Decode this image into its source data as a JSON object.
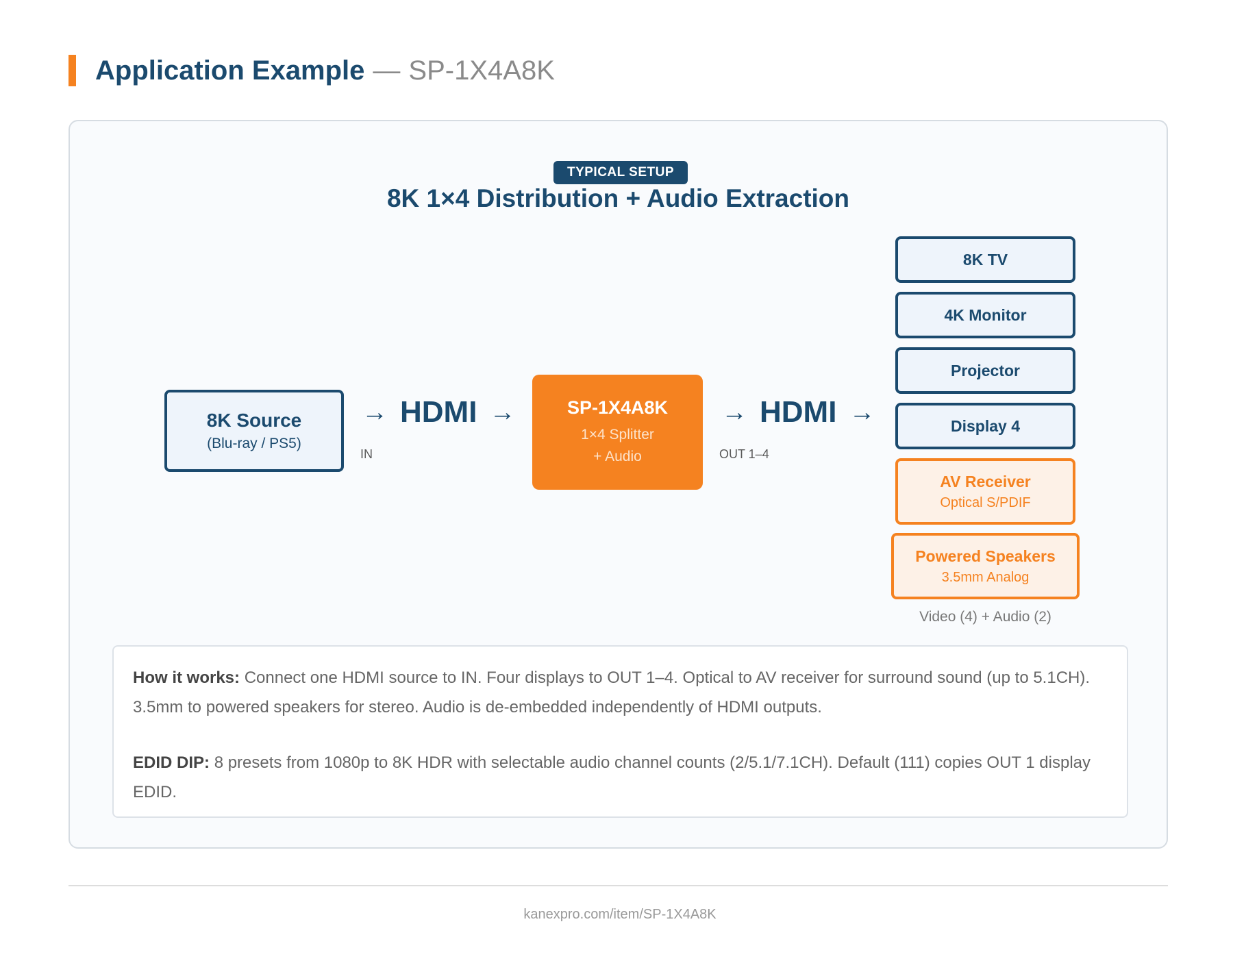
{
  "header": {
    "title": "Application Example",
    "separator": "—",
    "model": "SP-1X4A8K"
  },
  "diagram": {
    "badge": "TYPICAL SETUP",
    "title": "8K 1×4 Distribution + Audio Extraction",
    "source": {
      "name": "8K Source",
      "sub": "(Blu-ray / PS5)"
    },
    "input_link": {
      "arrow_left": "→",
      "label": "HDMI",
      "arrow_right": "→",
      "port": "IN"
    },
    "splitter": {
      "name": "SP-1X4A8K",
      "line1": "1×4 Splitter",
      "line2": "+ Audio"
    },
    "output_link": {
      "arrow_left": "→",
      "label": "HDMI",
      "arrow_right": "→",
      "port": "OUT 1–4"
    },
    "destinations": [
      {
        "name": "8K TV"
      },
      {
        "name": "4K Monitor"
      },
      {
        "name": "Projector"
      },
      {
        "name": "Display 4"
      },
      {
        "name": "AV Receiver",
        "sub": "Optical S/PDIF"
      },
      {
        "name": "Powered Speakers",
        "sub": "3.5mm Analog"
      }
    ],
    "outputs_note": "Video (4) + Audio (2)"
  },
  "info": {
    "how_label": "How it works:",
    "how_text": "Connect one HDMI source to IN. Four displays to OUT 1–4. Optical to AV receiver for surround sound (up to 5.1CH). 3.5mm to powered speakers for stereo. Audio is de-embedded independently of HDMI outputs.",
    "edid_label": "EDID DIP:",
    "edid_text": "8 presets from 1080p to 8K HDR with selectable audio channel counts (2/5.1/7.1CH). Default (111) copies OUT 1 display EDID."
  },
  "footer": {
    "url": "kanexpro.com/item/SP-1X4A8K"
  },
  "colors": {
    "navy": "#1b4a6e",
    "orange": "#f58220",
    "muted": "#8a8a8a"
  }
}
